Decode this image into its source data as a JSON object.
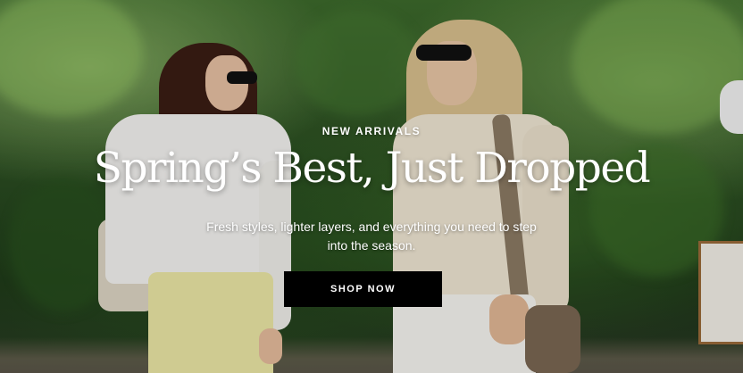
{
  "hero": {
    "eyebrow": "NEW ARRIVALS",
    "headline": "Spring’s Best, Just Dropped",
    "subtext": "Fresh styles, lighter layers, and everything you need to step into the season.",
    "cta_label": "SHOP NOW"
  },
  "colors": {
    "text": "#ffffff",
    "button_bg": "#000000",
    "button_text": "#ffffff"
  }
}
